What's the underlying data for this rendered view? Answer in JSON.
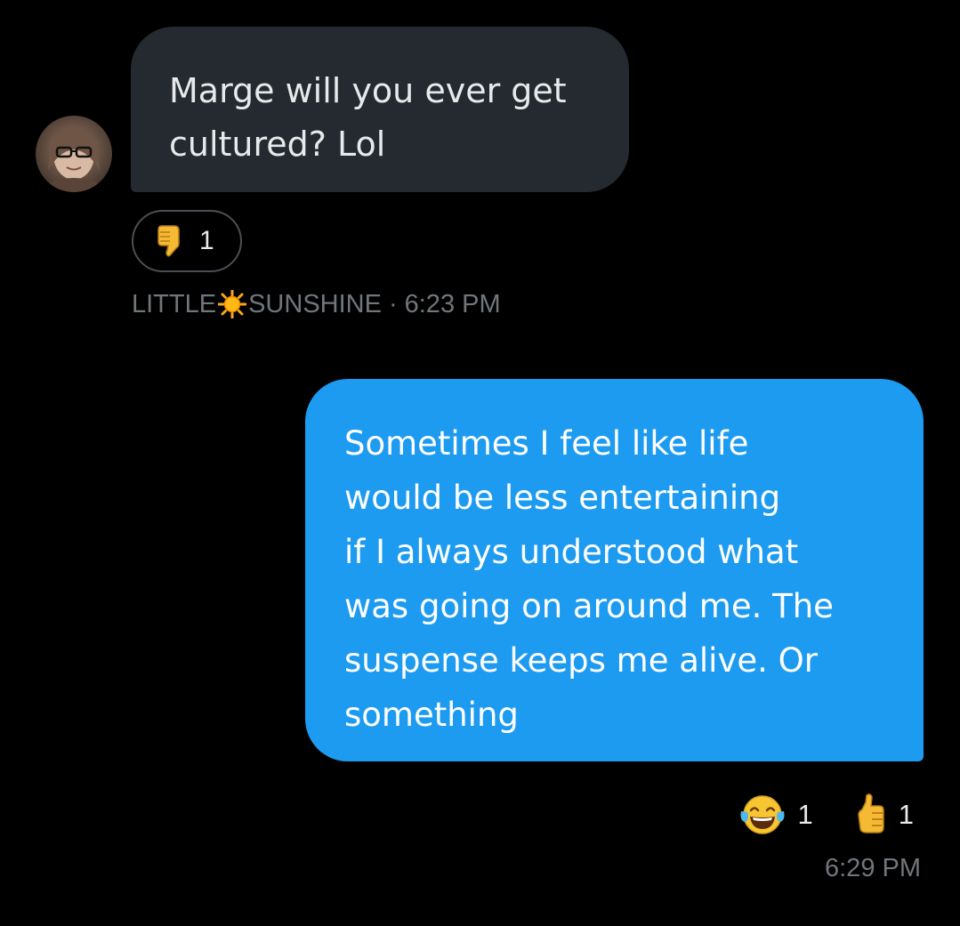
{
  "conversation": {
    "messages": [
      {
        "direction": "incoming",
        "text": "Marge will you ever get\ncultured? Lol",
        "reaction": {
          "icon": "thumbs-down-icon",
          "count": "1"
        },
        "meta": {
          "sender_prefix": "LITTLE",
          "sender_icon": "sun-icon",
          "sender_suffix": "SUNSHINE",
          "separator": "·",
          "time": "6:23 PM"
        }
      },
      {
        "direction": "outgoing",
        "text": "Sometimes I feel like life\nwould be less entertaining\nif I always understood what\nwas going on around me. The\nsuspense keeps me alive. Or\nsomething",
        "reactions": [
          {
            "icon": "tears-of-joy-icon",
            "count": "1"
          },
          {
            "icon": "thumbs-up-icon",
            "count": "1"
          }
        ],
        "meta": {
          "time": "6:29 PM"
        }
      }
    ]
  },
  "colors": {
    "background": "#000000",
    "incoming_bubble": "#242a30",
    "outgoing_bubble": "#1d9bf0",
    "meta_text": "#71767b",
    "text": "#e7e9ea"
  }
}
